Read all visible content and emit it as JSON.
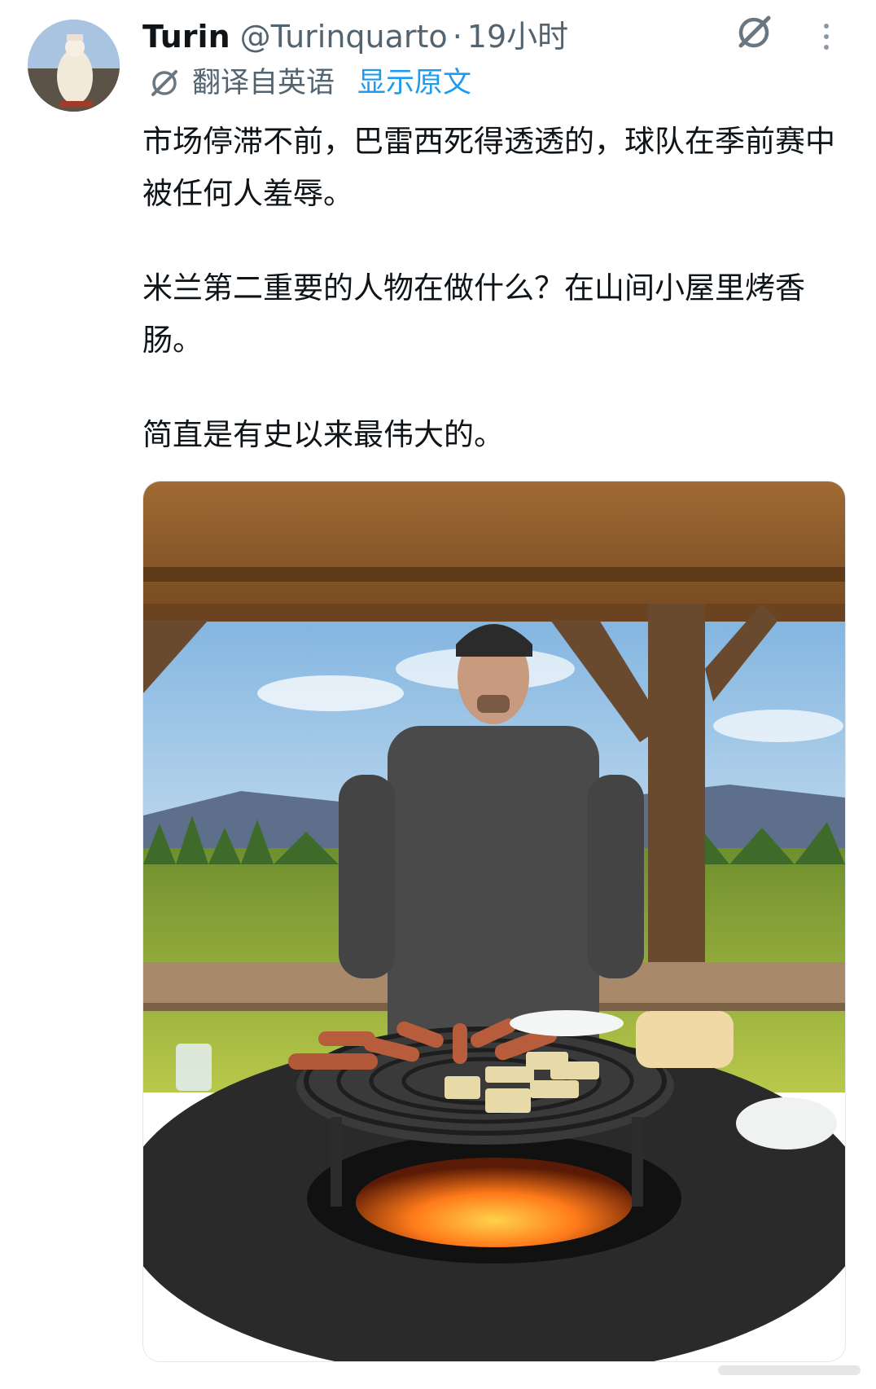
{
  "tweet": {
    "author_name": "Turin",
    "author_handle": "@Turinquarto",
    "separator": "·",
    "timestamp": "19小时",
    "translated_label": "翻译自英语",
    "show_original": "显示原文",
    "paragraphs": [
      "市场停滞不前，巴雷西死得透透的，球队在季前赛中被任何人羞辱。",
      "米兰第二重要的人物在做什么？在山间小屋里烤香肠。",
      "简直是有史以来最伟大的。"
    ]
  },
  "icons": {
    "grok": "grok-icon",
    "more": "more-options-icon",
    "translate": "translate-icon"
  },
  "colors": {
    "link": "#1d9bf0",
    "secondary_text": "#536471",
    "primary_text": "#0f1419"
  }
}
